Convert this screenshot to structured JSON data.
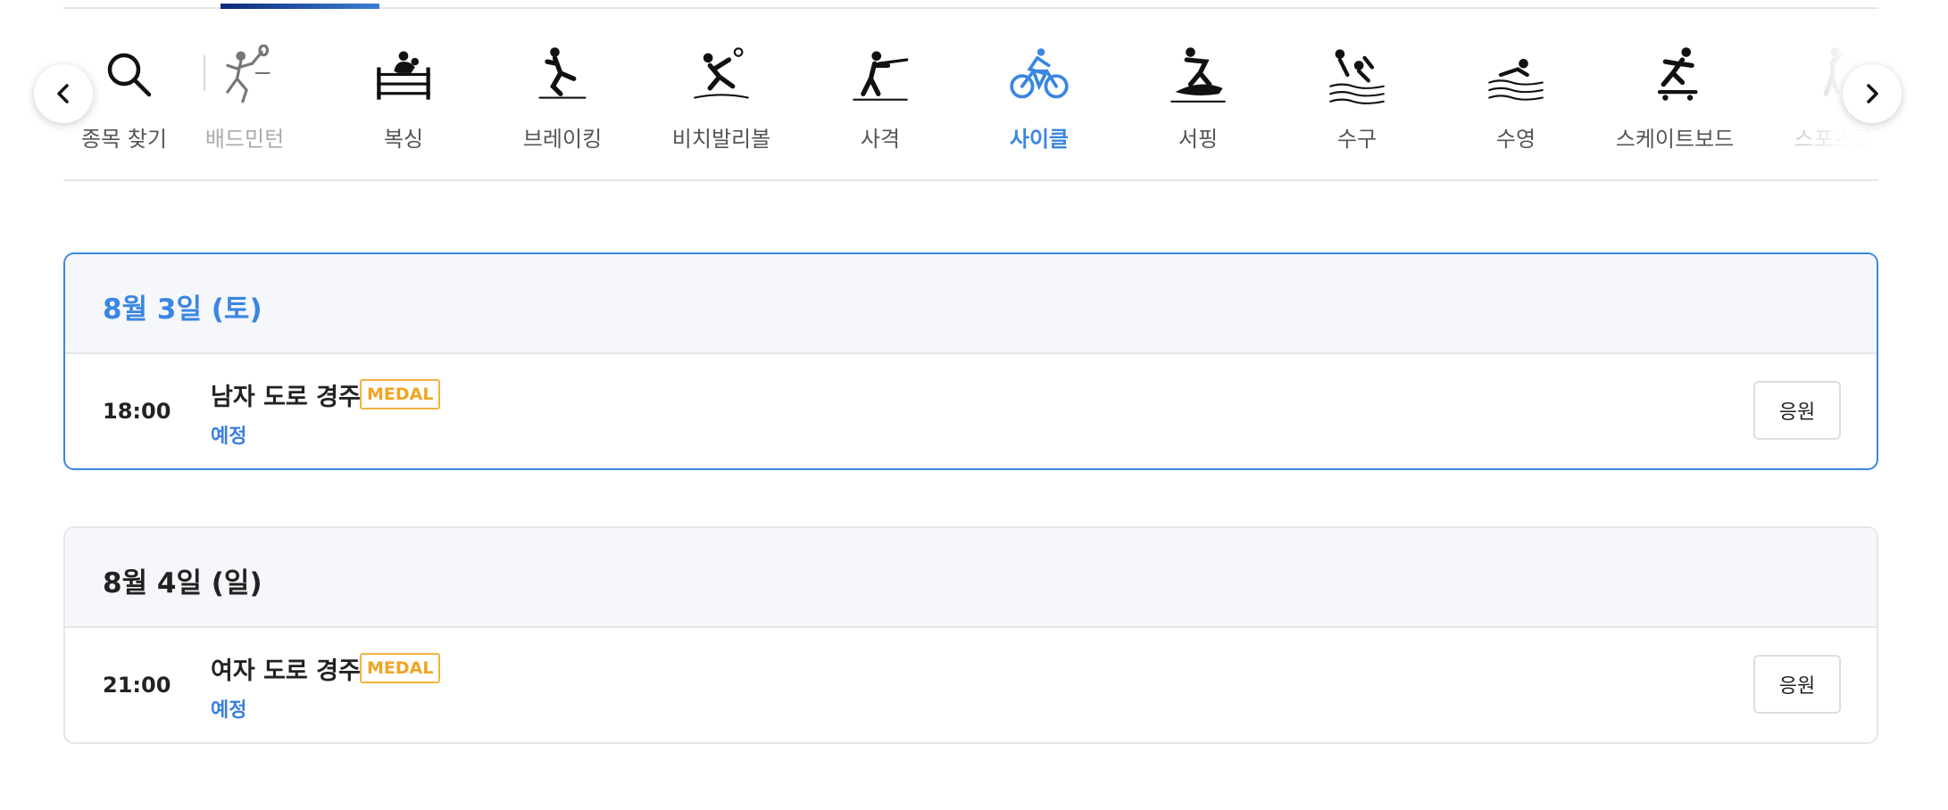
{
  "search": {
    "label": "종목 찾기",
    "icon": "search-icon"
  },
  "sports": [
    {
      "label": "배드민턴",
      "icon": "badminton-icon",
      "active": false
    },
    {
      "label": "복싱",
      "icon": "boxing-icon",
      "active": false
    },
    {
      "label": "브레이킹",
      "icon": "breaking-icon",
      "active": false
    },
    {
      "label": "비치발리볼",
      "icon": "beach-volleyball-icon",
      "active": false
    },
    {
      "label": "사격",
      "icon": "shooting-icon",
      "active": false
    },
    {
      "label": "사이클",
      "icon": "cycling-icon",
      "active": true
    },
    {
      "label": "서핑",
      "icon": "surfing-icon",
      "active": false
    },
    {
      "label": "수구",
      "icon": "water-polo-icon",
      "active": false
    },
    {
      "label": "수영",
      "icon": "swimming-icon",
      "active": false
    },
    {
      "label": "스케이트보드",
      "icon": "skateboard-icon",
      "active": false
    },
    {
      "label": "스포츠클",
      "icon": "sport-climbing-icon",
      "active": false
    }
  ],
  "nav": {
    "prev_icon": "chevron-left-icon",
    "next_icon": "chevron-right-icon"
  },
  "colors": {
    "accent": "#3a86e0",
    "medal": "#f0a525",
    "status": "#3a7fe0"
  },
  "schedule": [
    {
      "date": "8월 3일 (토)",
      "events": [
        {
          "time": "18:00",
          "name": "남자 도로 경주",
          "badge": "MEDAL",
          "status": "예정",
          "button": "응원"
        }
      ]
    },
    {
      "date": "8월 4일 (일)",
      "events": [
        {
          "time": "21:00",
          "name": "여자 도로 경주",
          "badge": "MEDAL",
          "status": "예정",
          "button": "응원"
        }
      ]
    }
  ]
}
